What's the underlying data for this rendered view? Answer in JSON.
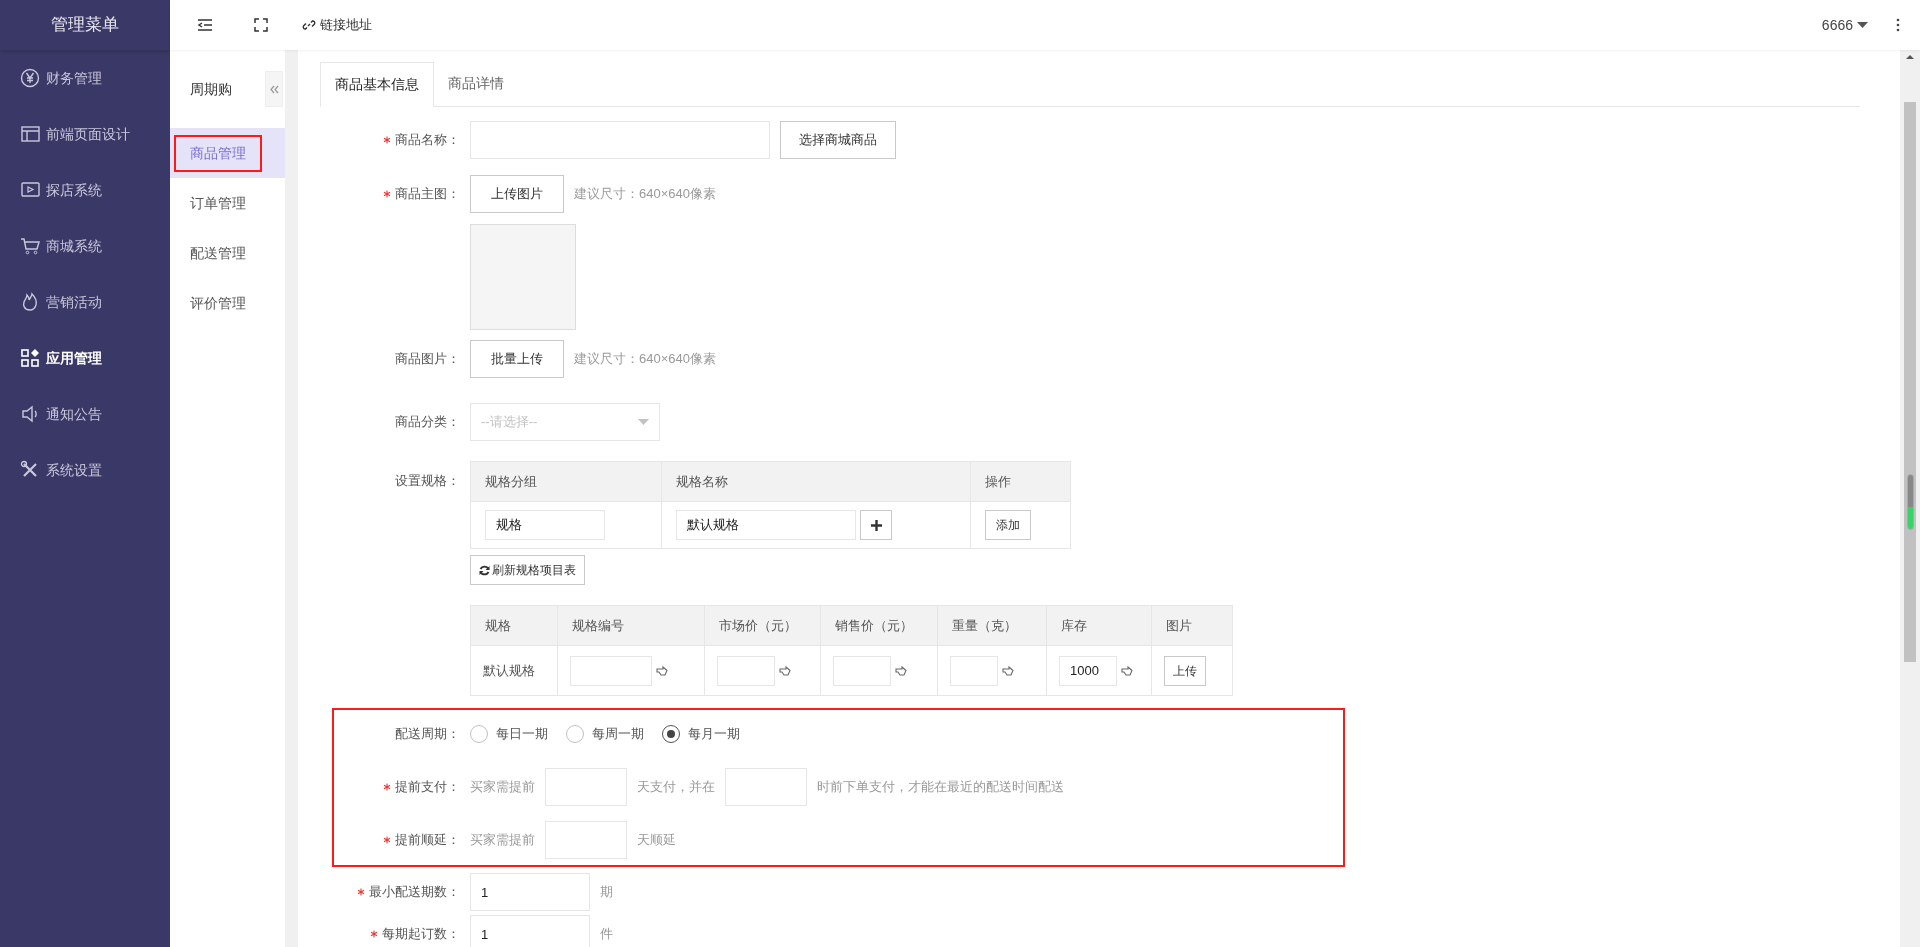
{
  "sidebar": {
    "title": "管理菜单",
    "items": [
      {
        "label": "财务管理",
        "kind": "yen",
        "selected": false
      },
      {
        "label": "前端页面设计",
        "kind": "layout",
        "selected": false
      },
      {
        "label": "探店系统",
        "kind": "video",
        "selected": false
      },
      {
        "label": "商城系统",
        "kind": "cart",
        "selected": false
      },
      {
        "label": "营销活动",
        "kind": "flame",
        "selected": false
      },
      {
        "label": "应用管理",
        "kind": "apps",
        "selected": true
      },
      {
        "label": "通知公告",
        "kind": "speaker",
        "selected": false
      },
      {
        "label": "系统设置",
        "kind": "tools",
        "selected": false
      }
    ]
  },
  "toolbar": {
    "link_label": "链接地址",
    "user": "6666"
  },
  "submenu": {
    "title": "周期购",
    "items": [
      {
        "label": "商品管理",
        "selected": true
      },
      {
        "label": "订单管理",
        "selected": false
      },
      {
        "label": "配送管理",
        "selected": false
      },
      {
        "label": "评价管理",
        "selected": false
      }
    ]
  },
  "tabs": [
    {
      "label": "商品基本信息",
      "selected": true
    },
    {
      "label": "商品详情",
      "selected": false
    }
  ],
  "form": {
    "product_name": {
      "label": "商品名称：",
      "required": true,
      "button": "选择商城商品"
    },
    "main_image": {
      "label": "商品主图：",
      "required": true,
      "button": "上传图片",
      "hint": "建议尺寸：640×640像素"
    },
    "gallery": {
      "label": "商品图片：",
      "required": false,
      "button": "批量上传",
      "hint": "建议尺寸：640×640像素"
    },
    "category": {
      "label": "商品分类：",
      "required": false,
      "placeholder": "--请选择--"
    },
    "spec": {
      "label": "设置规格：",
      "required": false,
      "columns": [
        "规格分组",
        "规格名称",
        "操作"
      ],
      "group": "规格",
      "name": "默认规格",
      "action": "添加",
      "refresh_button": "刷新规格项目表"
    },
    "sku_table": {
      "columns": [
        "规格",
        "规格编号",
        "市场价（元）",
        "销售价（元）",
        "重量（克）",
        "库存",
        "图片"
      ],
      "rows": [
        {
          "cells": [
            {
              "kind": "text",
              "text": "默认规格"
            },
            {
              "kind": "input"
            },
            {
              "kind": "input"
            },
            {
              "kind": "input"
            },
            {
              "kind": "input"
            },
            {
              "kind": "input",
              "value": "1000"
            },
            {
              "kind": "button",
              "text": "上传"
            }
          ]
        }
      ]
    },
    "delivery": {
      "label": "配送周期：",
      "required": false,
      "options": [
        {
          "label": "每日一期",
          "selected": false
        },
        {
          "label": "每周一期",
          "selected": false
        },
        {
          "label": "每月一期",
          "selected": true
        }
      ]
    },
    "advance_pay": {
      "label": "提前支付：",
      "required": true,
      "parts": [
        "买家需提前",
        "天支付，并在",
        "时前下单支付，才能在最近的配送时间配送"
      ]
    },
    "postpone": {
      "label": "提前顺延：",
      "required": true,
      "parts": [
        "买家需提前",
        "天顺延"
      ]
    },
    "min_periods": {
      "label": "最小配送期数：",
      "required": true,
      "value": "1",
      "unit": "期"
    },
    "per_period": {
      "label": "每期起订数：",
      "required": true,
      "value": "1",
      "unit": "件"
    }
  }
}
